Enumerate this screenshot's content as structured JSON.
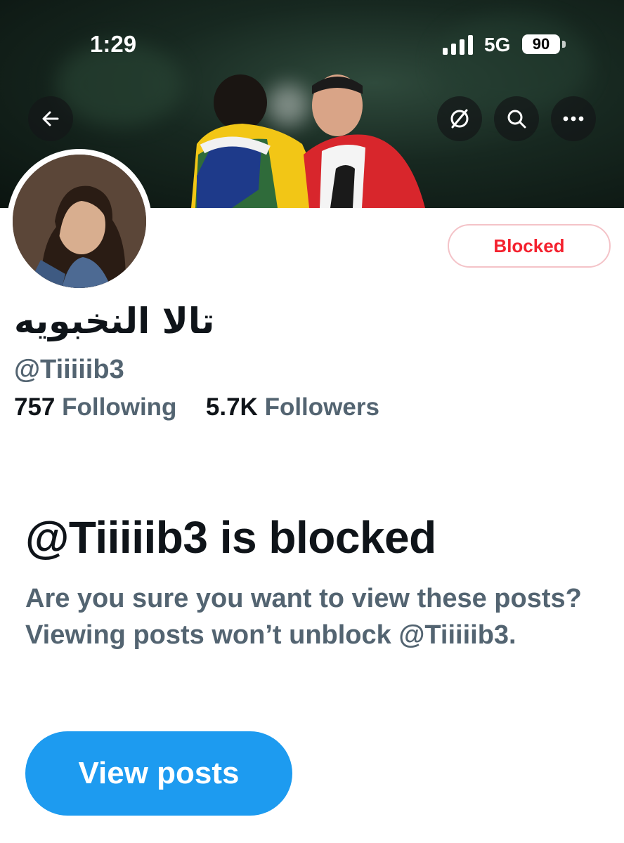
{
  "status_bar": {
    "time": "1:29",
    "network": "5G",
    "battery": "90"
  },
  "header": {
    "icons": [
      "back-arrow-icon",
      "translate-off-icon",
      "search-icon",
      "more-icon"
    ]
  },
  "profile": {
    "blocked_label": "Blocked",
    "display_name": "تالا النخبويه",
    "handle": "@Tiiiiib3",
    "following_count": "757",
    "following_label": "Following",
    "followers_count": "5.7K",
    "followers_label": "Followers"
  },
  "blocked_notice": {
    "title": "@Tiiiiib3 is blocked",
    "message": "Are you sure you want to view these posts? Viewing posts won’t unblock @Tiiiiib3.",
    "button_label": "View posts"
  },
  "colors": {
    "accent": "#1d9bf0",
    "blocked_red": "#f4212e",
    "text_primary": "#0f1419",
    "text_secondary": "#536471"
  }
}
